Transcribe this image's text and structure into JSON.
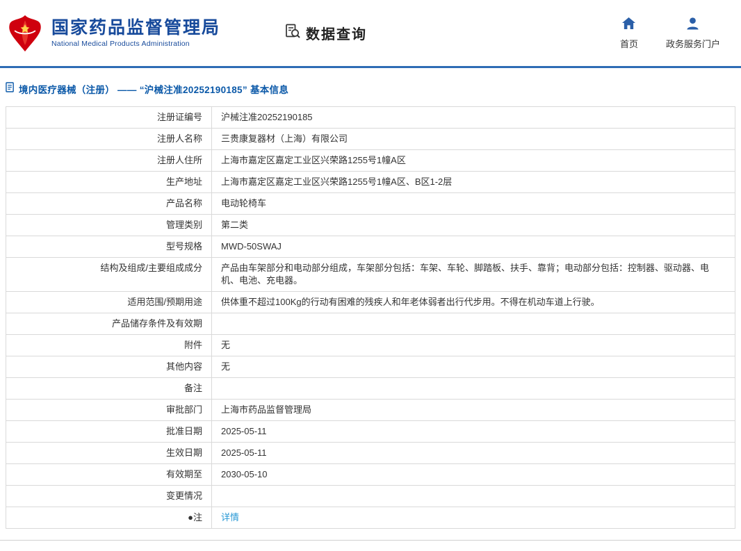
{
  "colors": {
    "brand_blue": "#174a9b",
    "divider_blue": "#2e6cb5",
    "breadcrumb_blue": "#0a58a8",
    "link_blue": "#2898d5",
    "logo_red": "#cf000e",
    "border_gray": "#d9d9d9"
  },
  "header": {
    "org_name_cn": "国家药品监督管理局",
    "org_name_en": "National Medical Products Administration",
    "section_title": "数据查询",
    "nav": [
      {
        "label": "首页",
        "icon": "home-icon"
      },
      {
        "label": "政务服务门户",
        "icon": "user-icon"
      }
    ]
  },
  "breadcrumb": {
    "text": "境内医疗器械（注册） —— “沪械注准20252190185” 基本信息",
    "icon": "document-icon"
  },
  "table": {
    "rows": [
      {
        "label": "注册证编号",
        "value": "沪械注准20252190185"
      },
      {
        "label": "注册人名称",
        "value": "三贵康复器材（上海）有限公司"
      },
      {
        "label": "注册人住所",
        "value": "上海市嘉定区嘉定工业区兴荣路1255号1幢A区"
      },
      {
        "label": "生产地址",
        "value": "上海市嘉定区嘉定工业区兴荣路1255号1幢A区、B区1-2层"
      },
      {
        "label": "产品名称",
        "value": "电动轮椅车"
      },
      {
        "label": "管理类别",
        "value": "第二类"
      },
      {
        "label": "型号规格",
        "value": "MWD-50SWAJ"
      },
      {
        "label": "结构及组成/主要组成成分",
        "value": "产品由车架部分和电动部分组成，车架部分包括：车架、车轮、脚踏板、扶手、靠背；电动部分包括：控制器、驱动器、电机、电池、充电器。"
      },
      {
        "label": "适用范围/预期用途",
        "value": "供体重不超过100Kg的行动有困难的残疾人和年老体弱者出行代步用。不得在机动车道上行驶。"
      },
      {
        "label": "产品储存条件及有效期",
        "value": ""
      },
      {
        "label": "附件",
        "value": "无"
      },
      {
        "label": "其他内容",
        "value": "无"
      },
      {
        "label": "备注",
        "value": ""
      },
      {
        "label": "审批部门",
        "value": "上海市药品监督管理局"
      },
      {
        "label": "批准日期",
        "value": "2025-05-11"
      },
      {
        "label": "生效日期",
        "value": "2025-05-11"
      },
      {
        "label": "有效期至",
        "value": "2030-05-10"
      },
      {
        "label": "变更情况",
        "value": ""
      },
      {
        "label": "●注",
        "value": "详情",
        "link": true
      }
    ]
  }
}
